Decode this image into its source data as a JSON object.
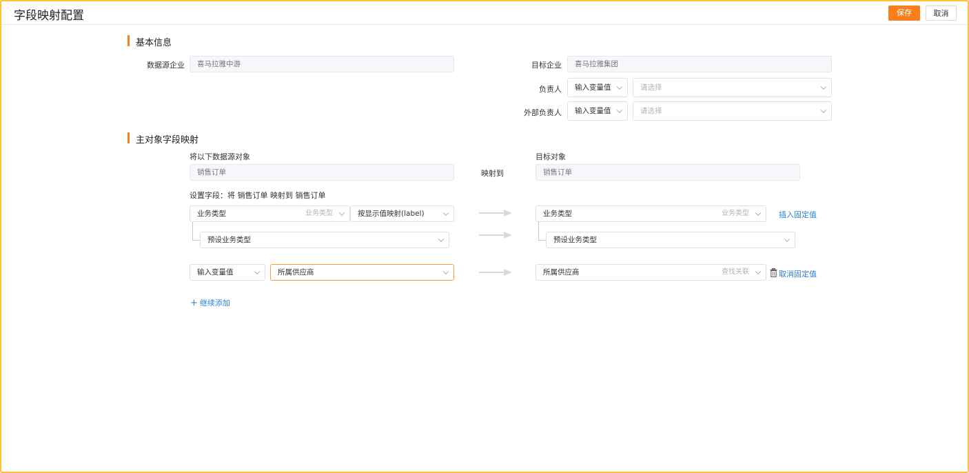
{
  "header": {
    "title": "字段映射配置",
    "save_label": "保存",
    "cancel_label": "取消"
  },
  "basic": {
    "section_title": "基本信息",
    "source_company_label": "数据源企业",
    "source_company_value": "喜马拉雅中游",
    "target_company_label": "目标企业",
    "target_company_value": "喜马拉雅集团",
    "owner_label": "负责人",
    "owner_mode": "输入变量值",
    "owner_placeholder": "请选择",
    "external_owner_label": "外部负责人",
    "external_owner_mode": "输入变量值",
    "external_owner_placeholder": "请选择"
  },
  "mapping": {
    "section_title": "主对象字段映射",
    "source_object_label": "将以下数据源对象",
    "source_object_value": "销售订单",
    "map_to_label": "映射到",
    "target_object_label": "目标对象",
    "target_object_value": "销售订单",
    "set_fields_text": "设置字段：将 销售订单 映射到 销售订单",
    "row1": {
      "source_field": "业务类型",
      "source_field_hint": "业务类型",
      "mapping_mode": "按显示值映射(label)",
      "target_field": "业务类型",
      "target_field_hint": "业务类型",
      "action_link": "插入固定值"
    },
    "row1_sub": {
      "source_value": "预设业务类型",
      "target_value": "预设业务类型"
    },
    "row2": {
      "source_mode": "输入变量值",
      "source_value": "所属供应商",
      "target_field": "所属供应商",
      "target_field_hint": "查找关联",
      "action_link": "取消固定值"
    },
    "add_more_label": "继续添加"
  },
  "icons": {
    "chevron": "chevron-down-icon",
    "arrow": "arrow-right-icon",
    "delete": "trash-icon",
    "add": "plus-icon"
  },
  "colors": {
    "accent": "#fa7f1c",
    "link": "#2d7fd6",
    "frame": "#ffc33a"
  }
}
